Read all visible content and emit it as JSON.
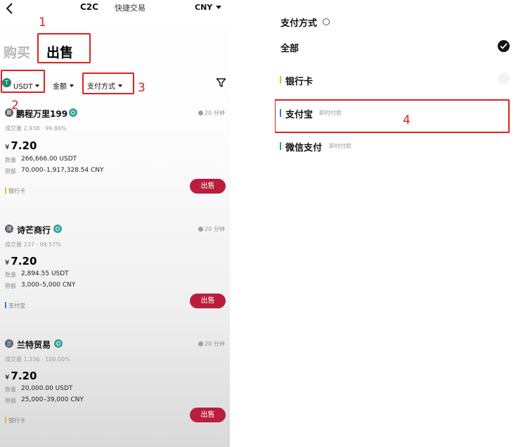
{
  "left": {
    "header": {
      "title": "C2C",
      "quick_trade": "快捷交易",
      "currency": "CNY"
    },
    "tabs": {
      "buy": "购买",
      "sell": "出售"
    },
    "filters": {
      "coin": "USDT",
      "coin_badge": "T",
      "amount": "金额",
      "payment": "支付方式"
    },
    "annotations": {
      "n1": "1",
      "n2": "2",
      "n3": "3"
    },
    "listings": [
      {
        "merchant": "鹏程万里199",
        "avatar": "鹏",
        "time": "20 分钟",
        "stats": "成交量 2,938 · 99.86%",
        "currency_symbol": "¥",
        "price": "7.20",
        "quantity_label": "数量",
        "quantity": "266,666.00 USDT",
        "limit_label": "限额",
        "limit": "70,000–1,917,328.54 CNY",
        "payment": "银行卡",
        "payment_color": "#e6b830",
        "action": "出售"
      },
      {
        "merchant": "诗芒商行",
        "avatar": "诗",
        "time": "20 分钟",
        "stats": "成交量 237 · 99.57%",
        "currency_symbol": "¥",
        "price": "7.20",
        "quantity_label": "数量",
        "quantity": "2,894.55 USDT",
        "limit_label": "限额",
        "limit": "3,000–5,000 CNY",
        "payment": "支付宝",
        "payment_color": "#2d7be5",
        "action": "出售"
      },
      {
        "merchant": "兰特贸易",
        "avatar": "兰",
        "time": "20 分钟",
        "stats": "成交量 1,336 · 100.00%",
        "currency_symbol": "¥",
        "price": "7.20",
        "quantity_label": "数量",
        "quantity": "20,000.00 USDT",
        "limit_label": "限额",
        "limit": "25,000–39,000 CNY",
        "payment": "银行卡",
        "payment_color": "#e6b830",
        "action": "出售"
      }
    ]
  },
  "right": {
    "title": "支付方式",
    "options": {
      "all": "全部",
      "bank": "银行卡",
      "alipay": "支付宝",
      "alipay_tag": "即时付款",
      "wechat": "微信支付",
      "wechat_tag": "即时付款"
    },
    "colors": {
      "bank": "#e6b830",
      "alipay": "#2d7be5",
      "wechat": "#2aa845"
    },
    "annotations": {
      "n4": "4"
    }
  }
}
